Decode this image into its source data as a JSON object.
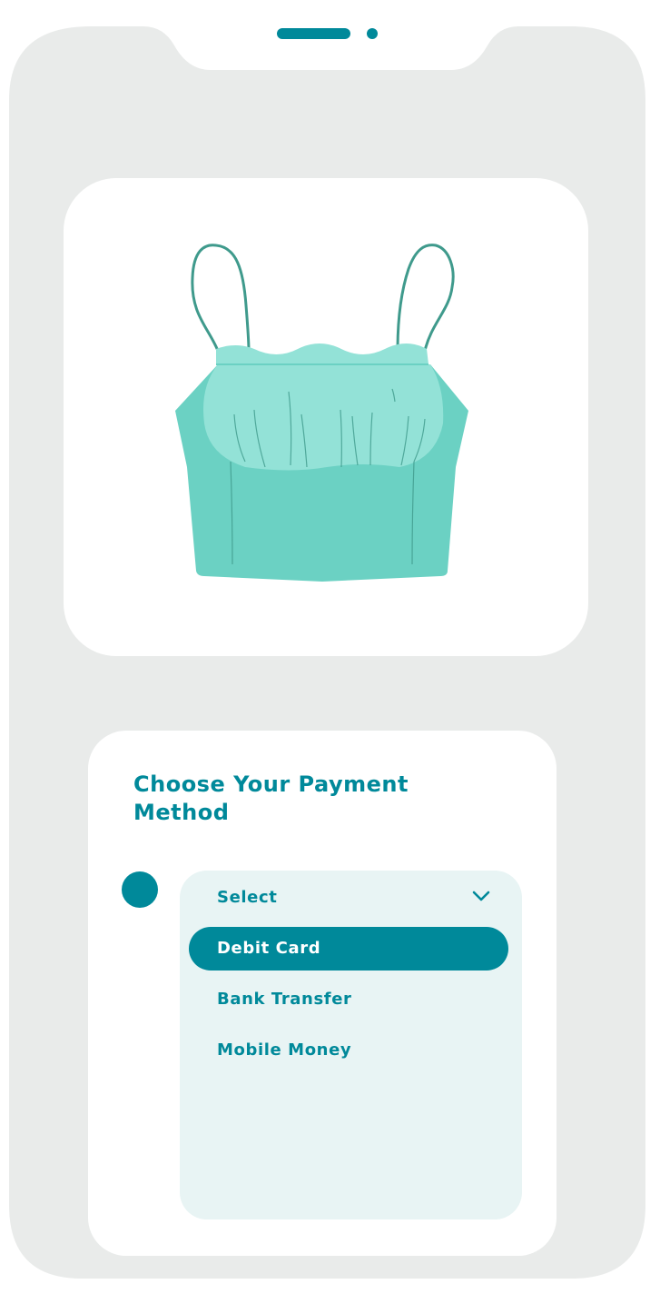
{
  "colors": {
    "accent": "#00899a",
    "frame": "#e9ebea",
    "card": "#ffffff",
    "dropdown_bg": "#e8f4f4",
    "garment_main": "#6bd1c3",
    "garment_light": "#93e2d7",
    "garment_shadow": "#3f9a8c"
  },
  "product": {
    "image_icon": "crop-top-garment-illustration"
  },
  "payment": {
    "title": "Choose Your Payment Method",
    "dropdown": {
      "placeholder": "Select",
      "chevron_icon": "chevron-down-icon",
      "selected": "Debit Card",
      "options": [
        "Debit Card",
        "Bank Transfer",
        "Mobile Money"
      ]
    }
  }
}
